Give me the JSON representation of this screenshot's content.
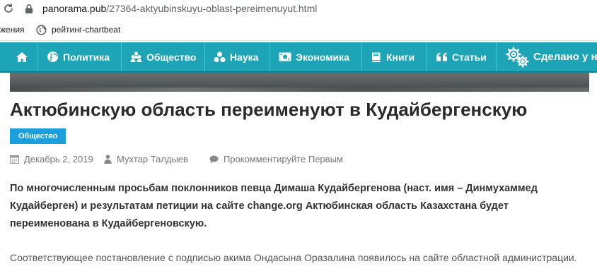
{
  "browser": {
    "url_host": "panorama.pub",
    "url_path": "/27364-aktyubinskuyu-oblast-pereimenuyut.html"
  },
  "bookmarks": [
    {
      "label": "жения"
    },
    {
      "label": "рейтинг-chartbeat"
    }
  ],
  "nav": {
    "items": [
      {
        "label": "Политика",
        "icon": "globe-icon"
      },
      {
        "label": "Общество",
        "icon": "people-icon"
      },
      {
        "label": "Наука",
        "icon": "atom-icon"
      },
      {
        "label": "Экономика",
        "icon": "money-icon"
      },
      {
        "label": "Книги",
        "icon": "book-icon"
      },
      {
        "label": "Статьи",
        "icon": "quote-icon"
      },
      {
        "label": "Сделано у на",
        "icon": "gears-icon"
      }
    ],
    "home_icon": "home-icon"
  },
  "article": {
    "title": "Актюбинскую область переименуют в Кудайбергенскую",
    "category": "Общество",
    "date": "Декабрь 2, 2019",
    "author": "Мухтар Талдыев",
    "comments": "Прокомментируйте Первым",
    "lead": "По многочисленным просьбам поклонников певца Димаша Кудайбергенова (наст. имя – Динмухаммед Кудайберген) и результатам петиции на сайте change.org Актюбинская область Казахстана будет переименована в Кудайбергеновскую.",
    "body": "Соответствующее постановление с подписью акима Ондасына Оразалина появилось на сайте областной администрации."
  },
  "colors": {
    "nav_bg": "#1da4b6",
    "badge_bg": "#1a9edc"
  }
}
